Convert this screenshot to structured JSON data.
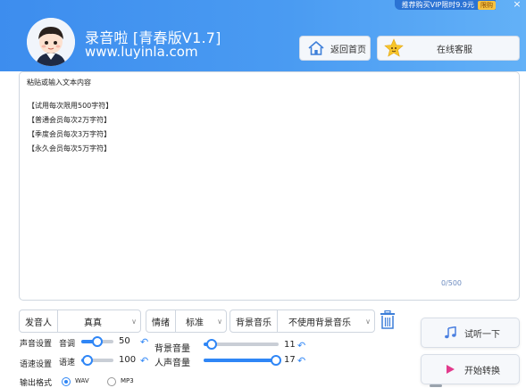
{
  "header": {
    "promo_text": "推荐购买VIP限时9.9元",
    "promo_badge": "限购",
    "close": "×",
    "title": "录音啦 [青春版V1.7]",
    "url": "www.luyinla.com",
    "home_label": "返回首页",
    "service_label": "在线客服"
  },
  "editor": {
    "placeholder": "粘贴或输入文本内容",
    "lines": [
      "【试用每次限用500字符】",
      "【普通会员每次2万字符】",
      "【季度会员每次3万字符】",
      "【永久会员每次5万字符】"
    ],
    "counter": "0/500"
  },
  "selectors": {
    "speaker_label": "发音人",
    "speaker_value": "真真",
    "emotion_label": "情绪",
    "emotion_value": "标准",
    "bgm_label": "背景音乐",
    "bgm_value": "不使用背景音乐"
  },
  "voice": {
    "row_label": "声音设置",
    "pitch_label": "音调",
    "pitch_value": "50",
    "pitch_level": 0.5,
    "bg_volume_label": "背景音量",
    "bg_volume_value": "11",
    "bg_volume_level": 0.11
  },
  "speed": {
    "row_label": "语速设置",
    "speed_label": "语速",
    "speed_value": "100",
    "speed_level": 0.2,
    "vocal_volume_label": "人声音量",
    "vocal_volume_value": "17",
    "vocal_volume_level": 0.97
  },
  "format": {
    "row_label": "输出格式",
    "options": [
      "WAV",
      "MP3"
    ],
    "selected": "WAV"
  },
  "actions": {
    "preview_label": "试听一下",
    "convert_label": "开始转换"
  },
  "colors": {
    "header_blue": "#3d8dee",
    "accent": "#2f86f6",
    "convert_icon": "#e23a8c",
    "preview_icon": "#4a7fe0"
  }
}
